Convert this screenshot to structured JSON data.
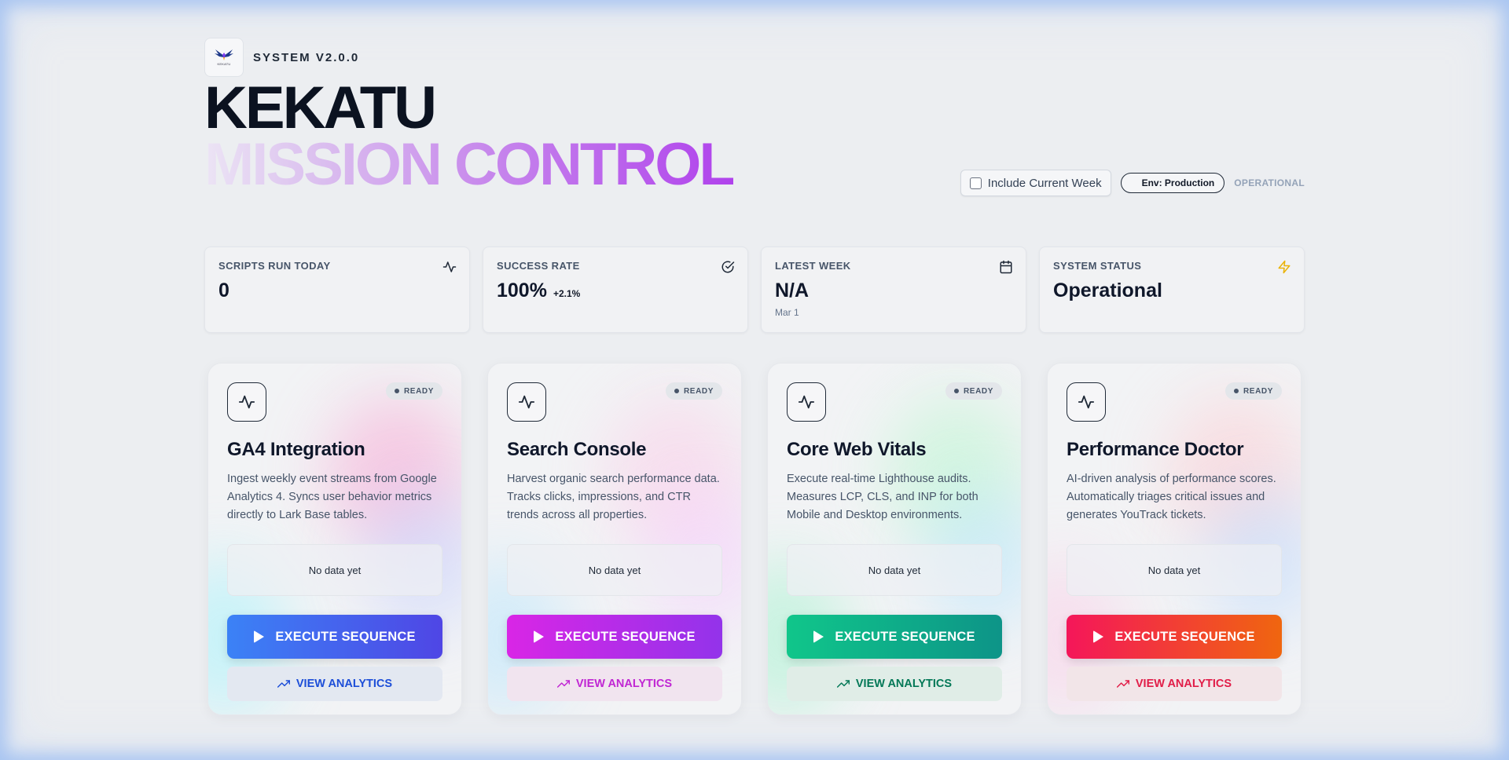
{
  "header": {
    "logo_text": "KEKATU",
    "version": "SYSTEM V2.0.0",
    "title_line1": "KEKATU",
    "title_line2": "MISSION CONTROL"
  },
  "controls": {
    "include_week_label": "Include Current Week",
    "include_week_checked": false,
    "env_label": "Env: Production",
    "status_label": "OPERATIONAL"
  },
  "stats": [
    {
      "label": "SCRIPTS RUN TODAY",
      "value": "0",
      "delta": "",
      "sub": "",
      "icon": "activity-icon"
    },
    {
      "label": "SUCCESS RATE",
      "value": "100%",
      "delta": "+2.1%",
      "sub": "",
      "icon": "check-circle-icon"
    },
    {
      "label": "LATEST WEEK",
      "value": "N/A",
      "delta": "",
      "sub": "Mar 1",
      "icon": "calendar-icon"
    },
    {
      "label": "SYSTEM STATUS",
      "value": "Operational",
      "delta": "",
      "sub": "",
      "icon": "lightning-icon",
      "icon_color": "#eab308"
    }
  ],
  "cards": [
    {
      "title": "GA4 Integration",
      "description": "Ingest weekly event streams from Google Analytics 4. Syncs user behavior metrics directly to Lark Base tables.",
      "status": "READY",
      "no_data": "No data yet",
      "execute_label": "EXECUTE SEQUENCE",
      "analytics_label": "VIEW ANALYTICS",
      "gradient": [
        "#3b82f6",
        "#4f46e5"
      ],
      "accent": "#1d4ed8",
      "analytics_bg": "#e3e8f1"
    },
    {
      "title": "Search Console",
      "description": "Harvest organic search performance data. Tracks clicks, impressions, and CTR trends across all properties.",
      "status": "READY",
      "no_data": "No data yet",
      "execute_label": "EXECUTE SEQUENCE",
      "analytics_label": "VIEW ANALYTICS",
      "gradient": [
        "#d926e6",
        "#9333ea"
      ],
      "accent": "#c026d3",
      "analytics_bg": "#f1e4ef"
    },
    {
      "title": "Core Web Vitals",
      "description": "Execute real-time Lighthouse audits. Measures LCP, CLS, and INP for both Mobile and Desktop environments.",
      "status": "READY",
      "no_data": "No data yet",
      "execute_label": "EXECUTE SEQUENCE",
      "analytics_label": "VIEW ANALYTICS",
      "gradient": [
        "#10c68a",
        "#0d9488"
      ],
      "accent": "#047857",
      "analytics_bg": "#e0ede7"
    },
    {
      "title": "Performance Doctor",
      "description": "AI-driven analysis of performance scores. Automatically triages critical issues and generates YouTrack tickets.",
      "status": "READY",
      "no_data": "No data yet",
      "execute_label": "EXECUTE SEQUENCE",
      "analytics_label": "VIEW ANALYTICS",
      "gradient": [
        "#f4165a",
        "#f0660f"
      ],
      "accent": "#e11d48",
      "analytics_bg": "#f2e5e8"
    }
  ]
}
